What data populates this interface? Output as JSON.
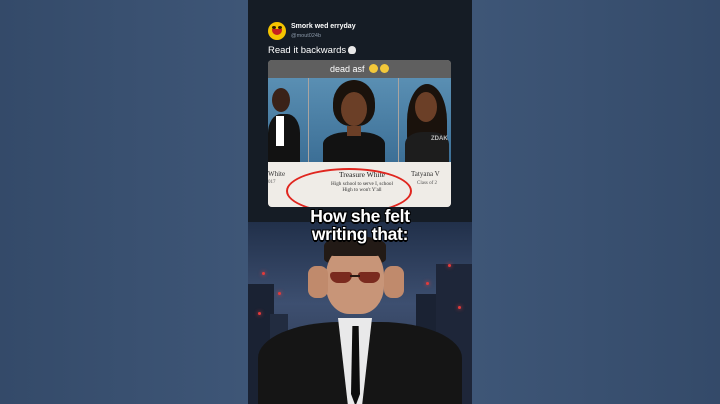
{
  "tweet": {
    "username": "Smork wed erryday",
    "handle": "@mout024b",
    "text": "Read it backwards",
    "emoji_icon": "skull-emoji"
  },
  "media": {
    "caption": "dead asf",
    "caption_emoji": "sick-face-emoji",
    "left_name": "White",
    "left_class": "017",
    "center_name": "Treasure White",
    "center_line1": "High school to serve I, school",
    "center_line2": "High to won't Y'all",
    "right_name": "Tatyana V",
    "right_class": "Class of 2",
    "watermark": "ZDAK",
    "highlight_color": "#e0261f"
  },
  "overlay": {
    "line1": "How she felt",
    "line2": "writing that:"
  },
  "colors": {
    "side_background": "#3a4f6e",
    "phone_background": "#151c25",
    "text_white": "#ffffff"
  }
}
